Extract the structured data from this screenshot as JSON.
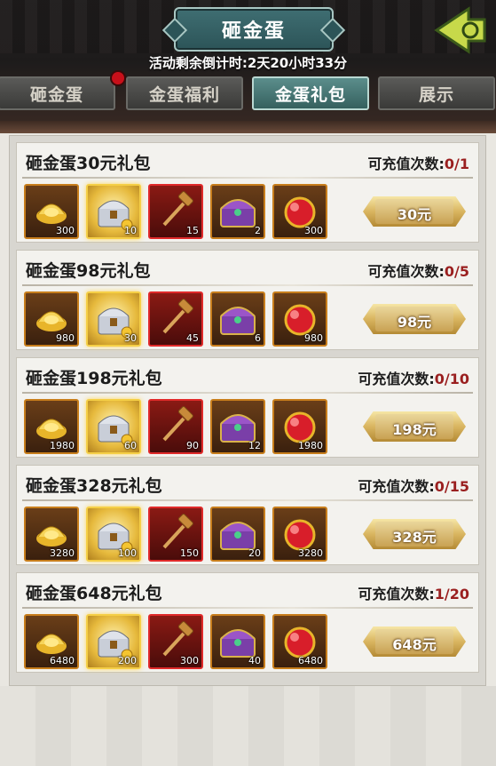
{
  "header": {
    "title": "砸金蛋",
    "countdown": "活动剩余倒计时:2天20小时33分",
    "tabs": [
      "砸金蛋",
      "金蛋福利",
      "金蛋礼包",
      "展示"
    ],
    "active_tab": 2
  },
  "packages": [
    {
      "title": "砸金蛋30元礼包",
      "limit_label": "可充值次数:",
      "limit_value": "0/1",
      "price": "30元",
      "items": [
        {
          "icon": "gold-ingot-icon",
          "qty": "300"
        },
        {
          "icon": "treasure-chest-icon",
          "qty": "10"
        },
        {
          "icon": "hammer-icon",
          "qty": "15"
        },
        {
          "icon": "purple-chest-icon",
          "qty": "2"
        },
        {
          "icon": "red-gem-icon",
          "qty": "300"
        }
      ]
    },
    {
      "title": "砸金蛋98元礼包",
      "limit_label": "可充值次数:",
      "limit_value": "0/5",
      "price": "98元",
      "items": [
        {
          "icon": "gold-ingot-icon",
          "qty": "980"
        },
        {
          "icon": "treasure-chest-icon",
          "qty": "30"
        },
        {
          "icon": "hammer-icon",
          "qty": "45"
        },
        {
          "icon": "purple-chest-icon",
          "qty": "6"
        },
        {
          "icon": "red-gem-icon",
          "qty": "980"
        }
      ]
    },
    {
      "title": "砸金蛋198元礼包",
      "limit_label": "可充值次数:",
      "limit_value": "0/10",
      "price": "198元",
      "items": [
        {
          "icon": "gold-ingot-icon",
          "qty": "1980"
        },
        {
          "icon": "treasure-chest-icon",
          "qty": "60"
        },
        {
          "icon": "hammer-icon",
          "qty": "90"
        },
        {
          "icon": "purple-chest-icon",
          "qty": "12"
        },
        {
          "icon": "red-gem-icon",
          "qty": "1980"
        }
      ]
    },
    {
      "title": "砸金蛋328元礼包",
      "limit_label": "可充值次数:",
      "limit_value": "0/15",
      "price": "328元",
      "items": [
        {
          "icon": "gold-ingot-icon",
          "qty": "3280"
        },
        {
          "icon": "treasure-chest-icon",
          "qty": "100"
        },
        {
          "icon": "hammer-icon",
          "qty": "150"
        },
        {
          "icon": "purple-chest-icon",
          "qty": "20"
        },
        {
          "icon": "red-gem-icon",
          "qty": "3280"
        }
      ]
    },
    {
      "title": "砸金蛋648元礼包",
      "limit_label": "可充值次数:",
      "limit_value": "1/20",
      "price": "648元",
      "items": [
        {
          "icon": "gold-ingot-icon",
          "qty": "6480"
        },
        {
          "icon": "treasure-chest-icon",
          "qty": "200"
        },
        {
          "icon": "hammer-icon",
          "qty": "300"
        },
        {
          "icon": "purple-chest-icon",
          "qty": "40"
        },
        {
          "icon": "red-gem-icon",
          "qty": "6480"
        }
      ]
    }
  ],
  "colors": {
    "accent_teal": "#35605e",
    "limit_red": "#9a1f1f",
    "gold": "#d9b560"
  }
}
